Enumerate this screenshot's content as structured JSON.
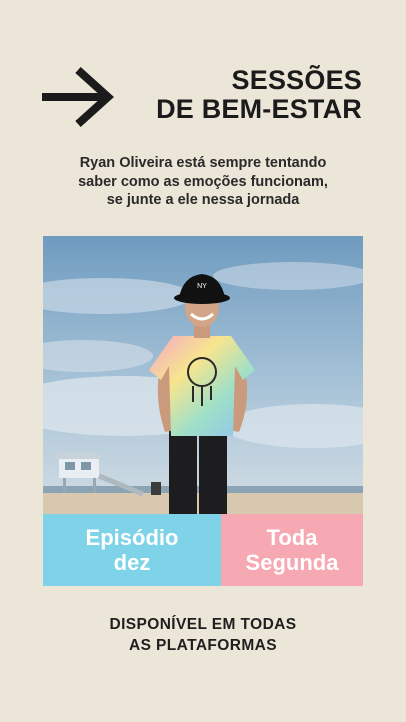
{
  "title": {
    "line1": "SESSÕES",
    "line2": "DE BEM-ESTAR"
  },
  "subtitle": {
    "line1": "Ryan Oliveira está sempre tentando",
    "line2": "saber como as emoções funcionam,",
    "line3": "se junte a ele nessa jornada"
  },
  "episode": {
    "line1": "Episódio",
    "line2": "dez"
  },
  "schedule": {
    "line1": "Toda",
    "line2": "Segunda"
  },
  "footer": {
    "line1": "DISPONÍVEL EM TODAS",
    "line2": "AS PLATAFORMAS"
  },
  "icons": {
    "arrow": "arrow-right-icon"
  },
  "colors": {
    "background": "#ebe6d8",
    "episode_badge": "#7fd3e8",
    "schedule_badge": "#f7a9b3",
    "text": "#1b1b1b"
  }
}
